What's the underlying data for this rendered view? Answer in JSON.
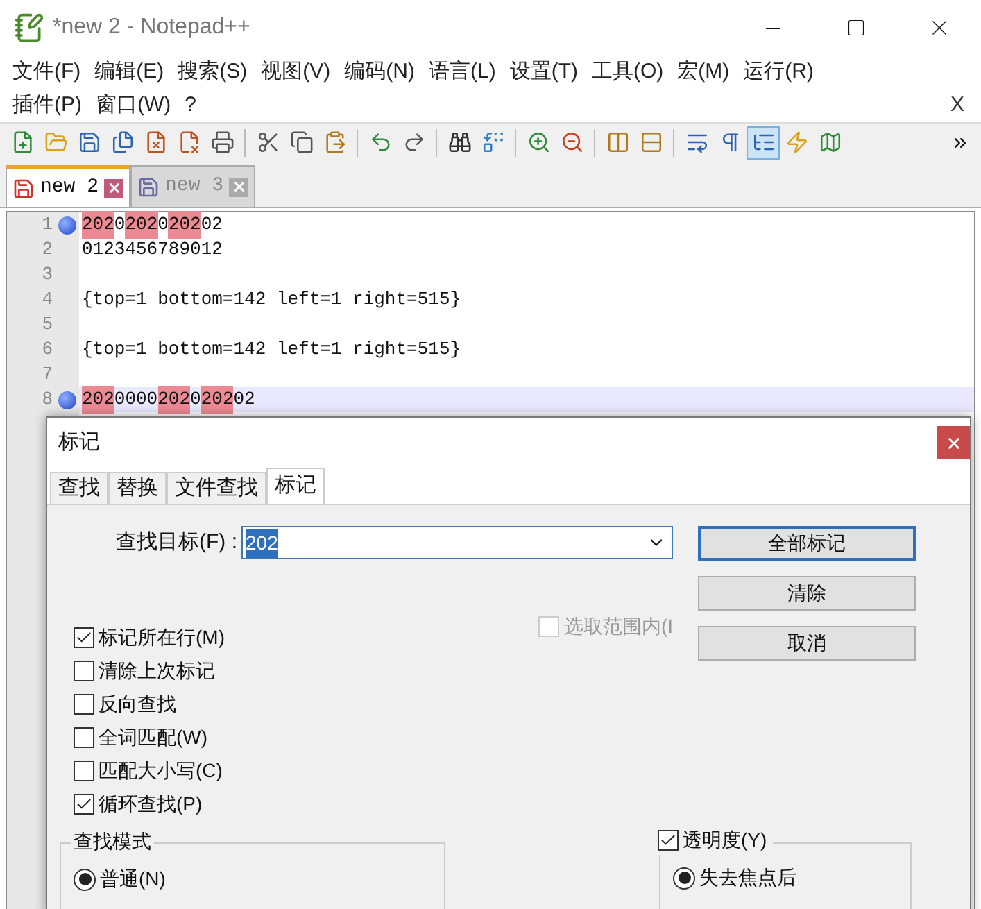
{
  "window": {
    "title": "*new 2 - Notepad++"
  },
  "menu": {
    "rows": [
      [
        "文件(F)",
        "编辑(E)",
        "搜索(S)",
        "视图(V)",
        "编码(N)",
        "语言(L)",
        "设置(T)",
        "工具(O)",
        "宏(M)",
        "运行(R)"
      ],
      [
        "插件(P)",
        "窗口(W)",
        "?"
      ]
    ],
    "close": "X"
  },
  "toolbar": [
    {
      "pressed": false
    },
    {
      "pressed": false
    },
    {
      "pressed": false
    },
    {
      "pressed": false
    },
    {
      "pressed": false
    },
    {
      "pressed": false
    },
    {
      "pressed": false
    },
    {
      "pressed": false
    },
    {
      "pressed": false
    },
    {
      "pressed": false
    },
    {
      "pressed": false
    },
    {
      "pressed": false
    },
    {
      "pressed": false
    },
    {
      "pressed": false
    },
    {
      "pressed": false
    },
    {
      "pressed": false
    },
    {
      "pressed": false
    },
    {
      "pressed": false
    },
    {
      "pressed": false
    },
    {
      "pressed": false
    },
    {
      "pressed": true
    },
    {
      "pressed": false
    },
    {
      "pressed": false
    }
  ],
  "tabs": [
    {
      "label": "new 2",
      "selected": true
    },
    {
      "label": "new 3",
      "selected": false
    }
  ],
  "editor": {
    "lines": [
      {
        "number": "1",
        "bookmark": true,
        "current": false,
        "segments": [
          {
            "text": "202",
            "marked": true
          },
          {
            "text": "0",
            "marked": false
          },
          {
            "text": "202",
            "marked": true
          },
          {
            "text": "0",
            "marked": false
          },
          {
            "text": "202",
            "marked": true
          },
          {
            "text": "02",
            "marked": false
          }
        ]
      },
      {
        "number": "2",
        "bookmark": false,
        "current": false,
        "segments": [
          {
            "text": "0123456789012",
            "marked": false
          }
        ]
      },
      {
        "number": "3",
        "bookmark": false,
        "current": false
      },
      {
        "number": "4",
        "bookmark": false,
        "current": false,
        "segments": [
          {
            "text": "{top=1 bottom=142 left=1 right=515}",
            "marked": false
          }
        ]
      },
      {
        "number": "5",
        "bookmark": false,
        "current": false
      },
      {
        "number": "6",
        "bookmark": false,
        "current": false,
        "segments": [
          {
            "text": "{top=1 bottom=142 left=1 right=515}",
            "marked": false
          }
        ]
      },
      {
        "number": "7",
        "bookmark": false,
        "current": false
      },
      {
        "number": "8",
        "bookmark": true,
        "current": true,
        "segments": [
          {
            "text": "202",
            "marked": true
          },
          {
            "text": "0000",
            "marked": false
          },
          {
            "text": "202",
            "marked": true
          },
          {
            "text": "0",
            "marked": false
          },
          {
            "text": "202",
            "marked": true
          },
          {
            "text": "02",
            "marked": false
          }
        ]
      }
    ]
  },
  "dialog": {
    "title": "标记",
    "tabs": [
      {
        "label": "查找",
        "selected": false
      },
      {
        "label": "替换",
        "selected": false
      },
      {
        "label": "文件查找",
        "selected": false
      },
      {
        "label": "标记",
        "selected": true
      }
    ],
    "find_label": "查找目标(F) :",
    "find_value": "202",
    "value_selected": true,
    "buttons": [
      {
        "label": "全部标记",
        "default": true
      },
      {
        "label": "清除",
        "default": false
      },
      {
        "label": "取消",
        "default": false
      }
    ],
    "options": [
      {
        "label": "标记所在行(M)",
        "checked": true
      },
      {
        "label": "清除上次标记",
        "checked": false
      },
      {
        "label": "反向查找",
        "checked": false
      },
      {
        "label": "全词匹配(W)",
        "checked": false
      },
      {
        "label": "匹配大小写(C)",
        "checked": false
      },
      {
        "label": "循环查找(P)",
        "checked": true
      }
    ],
    "scope": {
      "label": "选取范围内(I",
      "checked": false,
      "disabled": true
    },
    "search_mode": {
      "title": "查找模式",
      "options": [
        {
          "label": "普通(N)",
          "selected": true
        }
      ]
    },
    "transparency": {
      "label": "透明度(Y)",
      "checked": true,
      "options": [
        {
          "label": "失去焦点后",
          "selected": true
        }
      ]
    }
  }
}
